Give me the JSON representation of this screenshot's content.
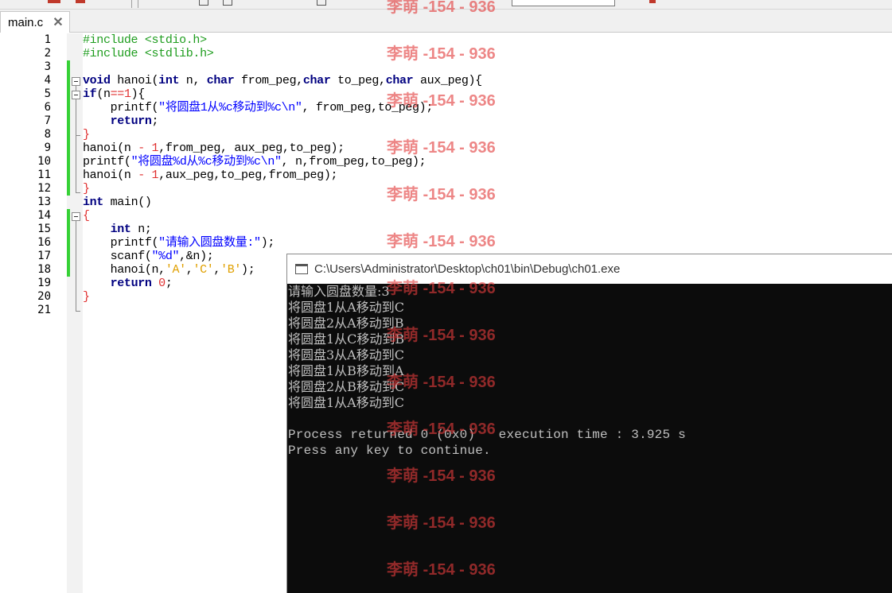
{
  "tab": {
    "label": "main.c",
    "close": "✕"
  },
  "editor": {
    "lines": [
      {
        "n": "1"
      },
      {
        "n": "2"
      },
      {
        "n": "3"
      },
      {
        "n": "4"
      },
      {
        "n": "5"
      },
      {
        "n": "6"
      },
      {
        "n": "7"
      },
      {
        "n": "8"
      },
      {
        "n": "9"
      },
      {
        "n": "10"
      },
      {
        "n": "11"
      },
      {
        "n": "12"
      },
      {
        "n": "13"
      },
      {
        "n": "14"
      },
      {
        "n": "15"
      },
      {
        "n": "16"
      },
      {
        "n": "17"
      },
      {
        "n": "18"
      },
      {
        "n": "19"
      },
      {
        "n": "20"
      },
      {
        "n": "21"
      }
    ],
    "code": {
      "l1": "#include <stdio.h>",
      "l2": "#include <stdlib.h>",
      "l4_kw1": "void",
      "l4_a": " hanoi(",
      "l4_kw2": "int",
      "l4_b": " n, ",
      "l4_kw3": "char",
      "l4_c": " from_peg,",
      "l4_kw4": "char",
      "l4_d": " to_peg,",
      "l4_kw5": "char",
      "l4_e": " aux_peg){",
      "l5_kw": "if",
      "l5_a": "(n",
      "l5_op": "==",
      "l5_num": "1",
      "l5_b": "){",
      "l6_a": "    printf(",
      "l6_str": "\"将圆盘1从%c移动到%c\\n\"",
      "l6_b": ", from_peg,to_peg);",
      "l7_pre": "    ",
      "l7_kw": "return",
      "l7_b": ";",
      "l8": "}",
      "l9_a": "hanoi(n ",
      "l9_op": "-",
      "l9_num": " 1",
      "l9_b": ",from_peg, aux_peg,to_peg);",
      "l10_a": "printf(",
      "l10_str": "\"将圆盘%d从%c移动到%c\\n\"",
      "l10_b": ", n,from_peg,to_peg);",
      "l11_a": "hanoi(n ",
      "l11_op": "-",
      "l11_num": " 1",
      "l11_b": ",aux_peg,to_peg,from_peg);",
      "l12": "}",
      "l13_kw": "int",
      "l13_b": " main()",
      "l14": "{",
      "l15_pre": "    ",
      "l15_kw": "int",
      "l15_b": " n;",
      "l16_a": "    printf(",
      "l16_str": "\"请输入圆盘数量:\"",
      "l16_b": ");",
      "l17_a": "    scanf(",
      "l17_str": "\"%d\"",
      "l17_b": ",&n);",
      "l18_a": "    hanoi(n,",
      "l18_c1": "'A'",
      "l18_s1": ",",
      "l18_c2": "'C'",
      "l18_s2": ",",
      "l18_c3": "'B'",
      "l18_b": ");",
      "l19_pre": "    ",
      "l19_kw": "return",
      "l19_num": " 0",
      "l19_b": ";",
      "l20": "}"
    }
  },
  "console": {
    "title": "C:\\Users\\Administrator\\Desktop\\ch01\\bin\\Debug\\ch01.exe",
    "lines": [
      "请输入圆盘数量:3",
      "将圆盘1从A移动到C",
      "将圆盘2从A移动到B",
      "将圆盘1从C移动到B",
      "将圆盘3从A移动到C",
      "将圆盘1从B移动到A",
      "将圆盘2从B移动到C",
      "将圆盘1从A移动到C",
      "",
      "Process returned 0 (0x0)   execution time : 3.925 s",
      "Press any key to continue."
    ]
  },
  "watermark": "李萌 -154 - 936",
  "colors": {
    "preprocessor": "#1f9d1f",
    "keyword": "#000080",
    "string": "#0000ff",
    "number": "#e03030",
    "char": "#e0a000",
    "changebar": "#36d136",
    "console_bg": "#0c0c0c",
    "console_text": "#c0c0c0",
    "watermark": "#e23c3c"
  }
}
